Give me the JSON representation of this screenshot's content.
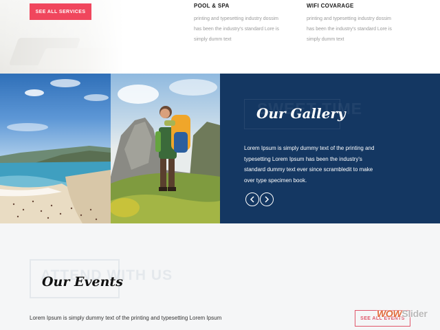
{
  "services": {
    "button_label": "SEE ALL SERVICES",
    "items": [
      {
        "title": "POOL & SPA",
        "lines": [
          "printing and typesetting industry dossim",
          "has been the industry's standard Lore is",
          "simply dumm text"
        ]
      },
      {
        "title": "WIFI COVARAGE",
        "lines": [
          "printing and typesetting industry dossim",
          "has been the industry's standard Lore is",
          "simply dumm text"
        ]
      }
    ]
  },
  "gallery": {
    "ghost_text": "SWEET TIME",
    "title": "Our Gallery",
    "lines": [
      "Lorem Ipsum is simply dummy text of the printing and",
      "typesetting Lorem Ipsum has been the industry's",
      "standard dummy text ever since scrambledit to make",
      "over type specimen book."
    ],
    "prev_icon": "chevron-left-icon",
    "next_icon": "chevron-right-icon",
    "colors": {
      "panel": "#143762"
    }
  },
  "events": {
    "ghost_text": "ATTEND WITH US",
    "title": "Our Events",
    "text": "Lorem Ipsum is simply dummy text of the printing and typesetting Lorem Ipsum",
    "button_label": "SEE ALL EVENTS"
  },
  "watermark": {
    "part1": "WOW",
    "part2": "Slider"
  },
  "colors": {
    "accent": "#f0465d",
    "background": "#f5f6f7"
  }
}
